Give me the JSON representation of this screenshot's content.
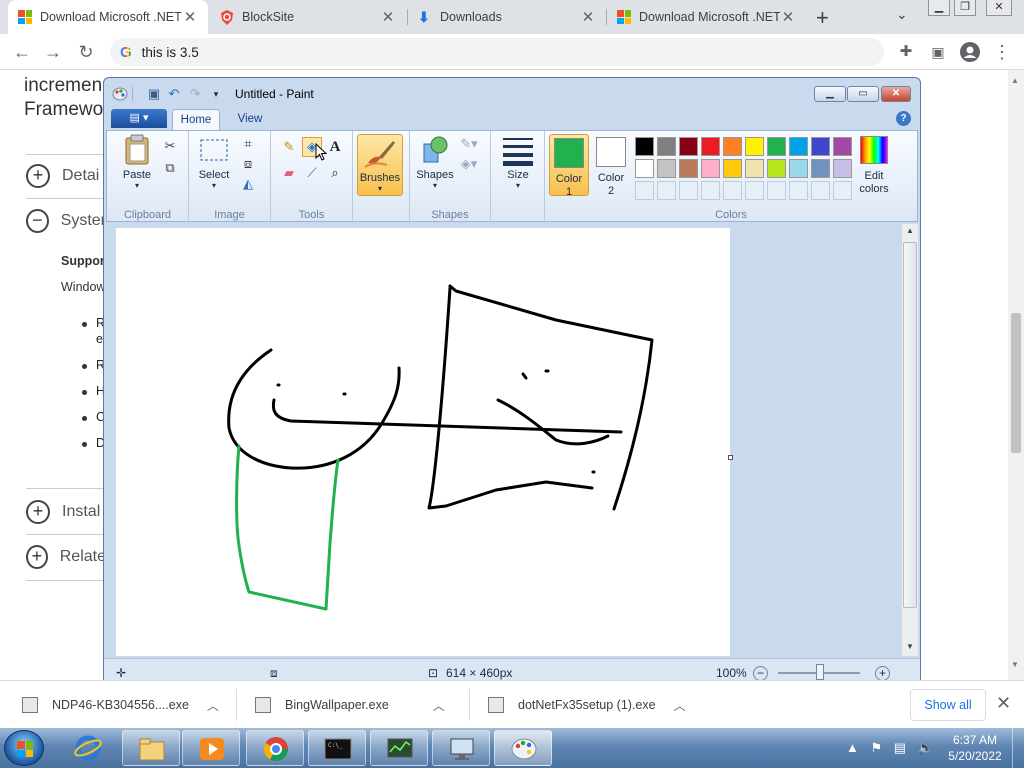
{
  "browser": {
    "tabs": [
      {
        "title": "Download Microsoft .NET",
        "icon": "microsoft-logo"
      },
      {
        "title": "BlockSite",
        "icon": "blocksite-shield"
      },
      {
        "title": "Downloads",
        "icon": "download-arrow"
      },
      {
        "title": "Download Microsoft .NET",
        "icon": "microsoft-logo"
      }
    ],
    "omnibox_text": "this is 3.5"
  },
  "page": {
    "heading_lines": [
      "incremen",
      "Framewo"
    ],
    "sections": [
      {
        "label": "Detai",
        "state": "collapsed"
      },
      {
        "label": "Syster",
        "state": "expanded"
      },
      {
        "label": "Instal",
        "state": "collapsed"
      },
      {
        "label": "Relate",
        "state": "collapsed"
      }
    ],
    "supported_label": "Suppor",
    "windows_label": "Window",
    "bullet_fragments": [
      "R",
      "e",
      "R",
      "H",
      "C",
      "D"
    ]
  },
  "paint": {
    "title": "Untitled - Paint",
    "tabs": [
      "Home",
      "View"
    ],
    "groups": {
      "clipboard": "Clipboard",
      "image": "Image",
      "tools": "Tools",
      "shapes": "Shapes",
      "colors": "Colors"
    },
    "buttons": {
      "paste": "Paste",
      "select": "Select",
      "brushes": "Brushes",
      "shapes": "Shapes",
      "size": "Size",
      "color1_l1": "Color",
      "color1_l2": "1",
      "color2_l1": "Color",
      "color2_l2": "2",
      "edit_colors_l1": "Edit",
      "edit_colors_l2": "colors"
    },
    "color1": "#22b14c",
    "color2": "#ffffff",
    "palette": [
      "#000000",
      "#7f7f7f",
      "#880015",
      "#ed1c24",
      "#ff7f27",
      "#fff200",
      "#22b14c",
      "#00a2e8",
      "#3f48cc",
      "#a349a4",
      "#ffffff",
      "#c3c3c3",
      "#b97a57",
      "#ffaec9",
      "#ffc90e",
      "#efe4b0",
      "#b5e61d",
      "#99d9ea",
      "#7092be",
      "#c8bfe7"
    ],
    "status": {
      "dimensions": "614 × 460px",
      "zoom": "100%"
    }
  },
  "downloads": {
    "items": [
      "NDP46-KB304556....exe",
      "BingWallpaper.exe",
      "dotNetFx35setup (1).exe"
    ],
    "show_all": "Show all"
  },
  "taskbar": {
    "apps": [
      "internet-explorer",
      "file-explorer",
      "media-player",
      "chrome",
      "command-prompt",
      "network-monitor",
      "remote-desktop",
      "paint"
    ],
    "time": "6:37 AM",
    "date": "5/20/2022"
  }
}
